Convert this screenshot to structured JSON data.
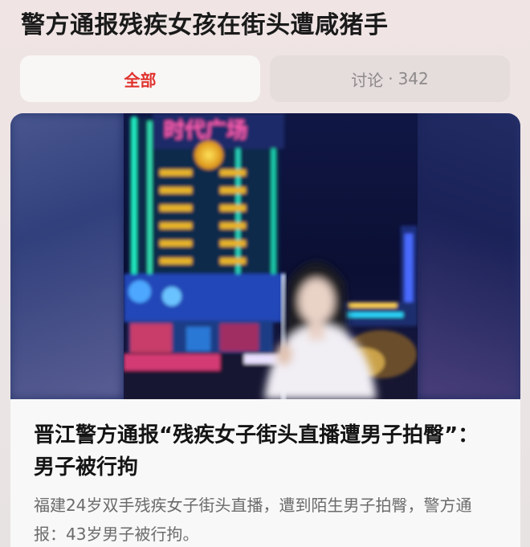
{
  "topic": {
    "title": "警方通报残疾女孩在街头遭咸猪手"
  },
  "tabs": {
    "all_label": "全部",
    "discuss_label": "讨论",
    "discuss_separator": "·",
    "discuss_count": "342",
    "active_color": "#e0342f"
  },
  "article": {
    "headline": "晋江警方通报“残疾女子街头直播遭男子拍臀”：男子被行拘",
    "summary": "福建24岁双手残疾女子街头直播，遭到陌生男子拍臀，警方通报：43岁男子被行拘。"
  }
}
